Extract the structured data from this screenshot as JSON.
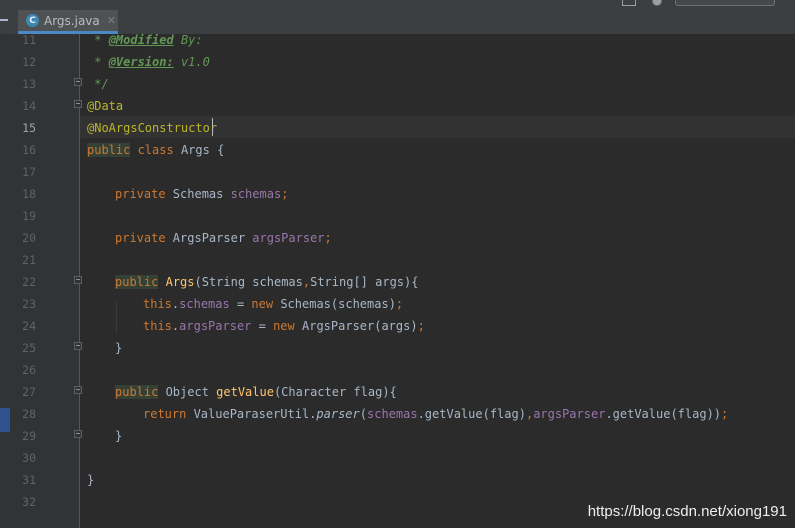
{
  "tab": {
    "icon_letter": "C",
    "label": "Args.java",
    "close": "✕"
  },
  "watermark": "https://blog.csdn.net/xiong191",
  "colors": {
    "background": "#2b2b2b",
    "keyword": "#cc7832",
    "annotation": "#bbb529",
    "field": "#9876aa",
    "method": "#ffc66d",
    "comment": "#629755",
    "text": "#a9b7c6"
  },
  "lines": [
    {
      "n": "11"
    },
    {
      "n": "12"
    },
    {
      "n": "13"
    },
    {
      "n": "14"
    },
    {
      "n": "15"
    },
    {
      "n": "16"
    },
    {
      "n": "17"
    },
    {
      "n": "18"
    },
    {
      "n": "19"
    },
    {
      "n": "20"
    },
    {
      "n": "21"
    },
    {
      "n": "22"
    },
    {
      "n": "23"
    },
    {
      "n": "24"
    },
    {
      "n": "25"
    },
    {
      "n": "26"
    },
    {
      "n": "27"
    },
    {
      "n": "28"
    },
    {
      "n": "29"
    },
    {
      "n": "30"
    },
    {
      "n": "31"
    },
    {
      "n": "32"
    }
  ],
  "code": {
    "l11": {
      "star": " * ",
      "tag": "@Modified",
      "rest": " By:"
    },
    "l12": {
      "star": " * ",
      "tag": "@Version:",
      "rest": " v1.0"
    },
    "l13": {
      "text": " */"
    },
    "l14": {
      "ann": "@Data"
    },
    "l15": {
      "ann": "@NoArgsConstructor"
    },
    "l16": {
      "kw1": "public",
      "kw2": " class",
      "rest": " Args {"
    },
    "l18": {
      "kw": "private",
      "type": " Schemas ",
      "field": "schemas",
      "semi": ";"
    },
    "l20": {
      "kw": "private",
      "type": " ArgsParser ",
      "field": "argsParser",
      "semi": ";"
    },
    "l22": {
      "kw": "public",
      "sp": " ",
      "name": "Args",
      "p1": "(String schemas",
      "comma": ",",
      "p2": "String[] args){"
    },
    "l23": {
      "kw": "this",
      "dot": ".",
      "field": "schemas",
      "eq": " = ",
      "kw2": "new",
      "rest": " Schemas(schemas)",
      "semi": ";"
    },
    "l24": {
      "kw": "this",
      "dot": ".",
      "field": "argsParser",
      "eq": " = ",
      "kw2": "new",
      "rest": " ArgsParser(args)",
      "semi": ";"
    },
    "l25": {
      "text": "}"
    },
    "l27": {
      "kw": "public",
      "type": " Object ",
      "name": "getValue",
      "rest": "(Character flag){"
    },
    "l28": {
      "kw": "return",
      "cls": " ValueParaserUtil.",
      "m": "parser",
      "o": "(",
      "f1": "schemas",
      "c1": ".getValue(flag)",
      "comma": ",",
      "f2": "argsParser",
      "c2": ".getValue(flag))",
      "semi": ";"
    },
    "l29": {
      "text": "}"
    },
    "l31": {
      "text": "}"
    }
  }
}
